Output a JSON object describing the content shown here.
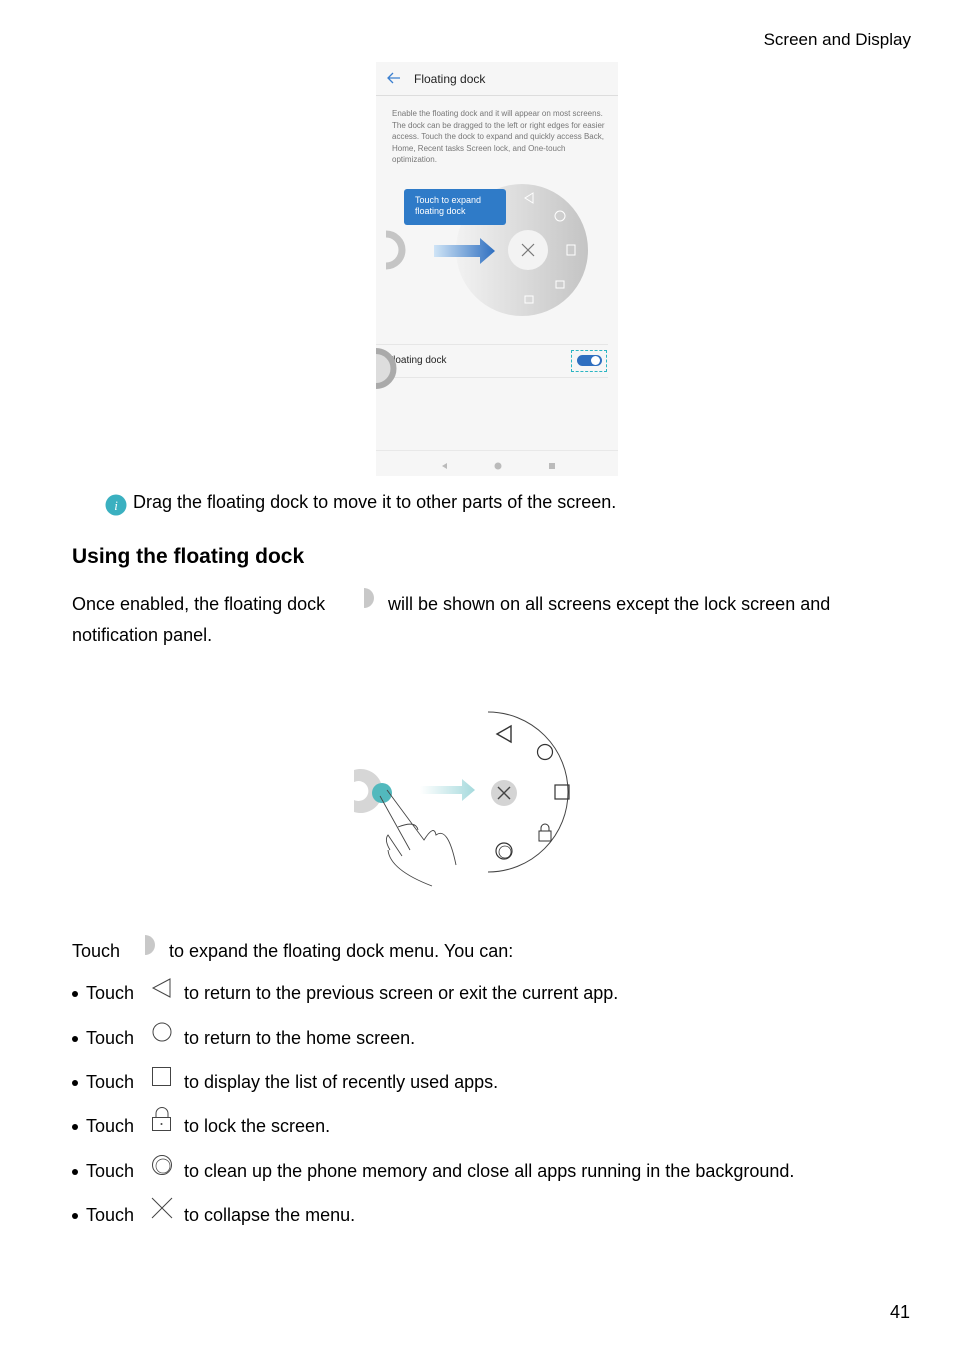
{
  "header": {
    "section": "Screen and Display"
  },
  "phone": {
    "title": "Floating dock",
    "description": "Enable the floating dock and it will appear on most screens. The dock can be dragged to the left or right edges for easier access. Touch the dock to expand and quickly access Back, Home, Recent tasks Screen lock, and One-touch optimization.",
    "tooltip": "Touch to expand floating dock",
    "setting_label": "Floating dock",
    "toggle_on": true,
    "accent": "#2f7bc8"
  },
  "note": "Drag the floating dock to move it to other parts of the screen.",
  "section_title": "Using the floating dock",
  "intro_before": "Once enabled, the floating dock",
  "intro_after": "will be shown on all screens except the lock screen and",
  "intro_line2": "notification panel.",
  "touch_line": {
    "before": "Touch",
    "after": "to expand the floating dock menu. You can:"
  },
  "bullets": [
    {
      "touch": "Touch",
      "icon": "back-triangle-icon",
      "text": "to return to the previous screen or exit the current app."
    },
    {
      "touch": "Touch",
      "icon": "home-circle-icon",
      "text": "to return to the home screen."
    },
    {
      "touch": "Touch",
      "icon": "recent-square-icon",
      "text": "to display the list of recently used apps."
    },
    {
      "touch": "Touch",
      "icon": "lock-icon",
      "text": "to lock the screen."
    },
    {
      "touch": "Touch",
      "icon": "optimize-ring-icon",
      "text": "to clean up the phone memory and close all apps running in the background."
    },
    {
      "touch": "Touch",
      "icon": "close-x-icon",
      "text": "to collapse the menu."
    }
  ],
  "page_number": "41"
}
